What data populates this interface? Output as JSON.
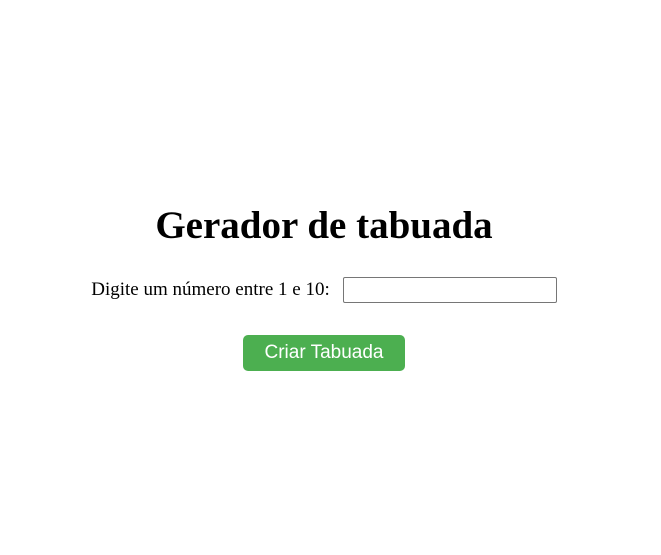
{
  "page": {
    "title": "Gerador de tabuada"
  },
  "form": {
    "label": "Digite um número entre 1 e 10:",
    "input_value": "",
    "input_placeholder": "",
    "button_label": "Criar Tabuada"
  },
  "colors": {
    "button_background": "#4caf50",
    "button_text": "#ffffff",
    "page_background": "#ffffff",
    "text": "#000000",
    "input_border": "#767676"
  }
}
